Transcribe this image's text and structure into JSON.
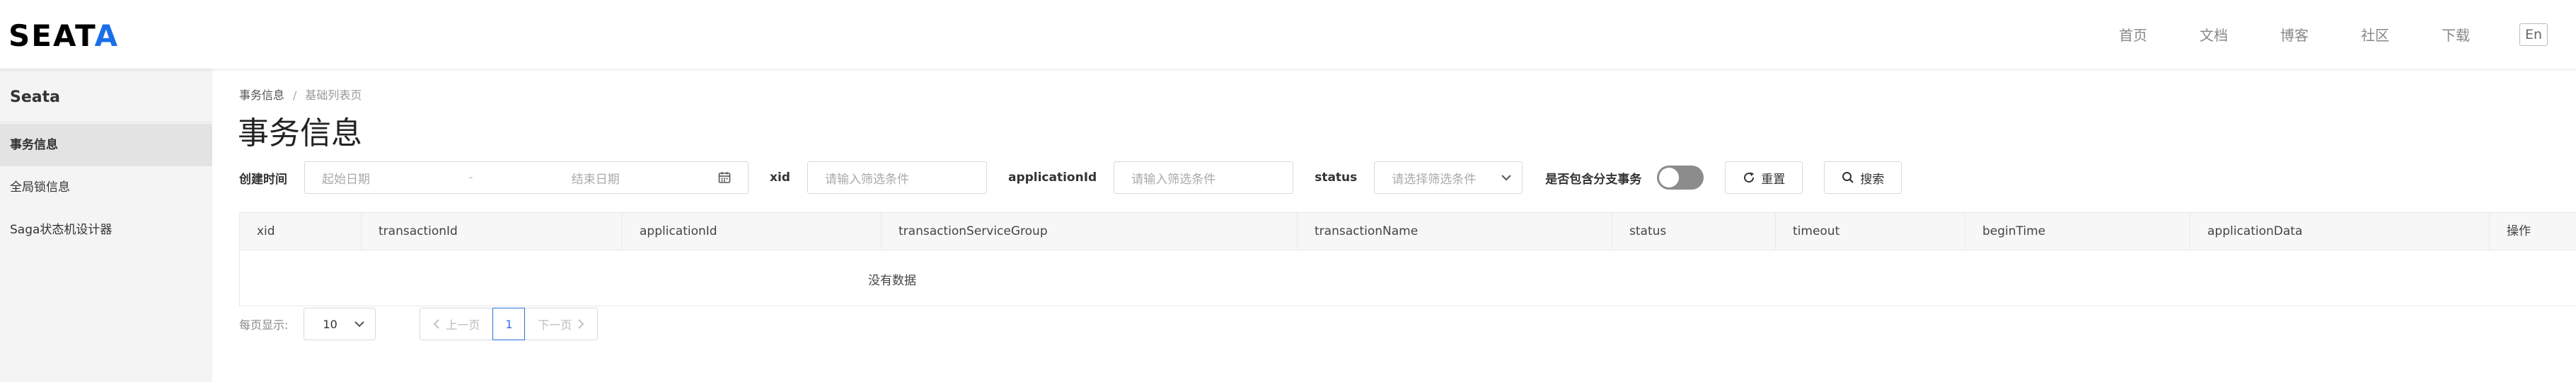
{
  "header": {
    "logo_main": "SEAT",
    "logo_accent": "A",
    "nav": [
      "首页",
      "文档",
      "博客",
      "社区",
      "下载"
    ],
    "lang": "En"
  },
  "sidebar": {
    "title": "Seata",
    "items": [
      {
        "label": "事务信息",
        "active": true
      },
      {
        "label": "全局锁信息",
        "active": false
      },
      {
        "label": "Saga状态机设计器",
        "active": false
      }
    ]
  },
  "breadcrumb": {
    "parent": "事务信息",
    "sep": "/",
    "current": "基础列表页"
  },
  "page_title": "事务信息",
  "filters": {
    "time_label": "创建时间",
    "start_placeholder": "起始日期",
    "range_dash": "-",
    "end_placeholder": "结束日期",
    "xid_label": "xid",
    "xid_placeholder": "请输入筛选条件",
    "app_label": "applicationId",
    "app_placeholder": "请输入筛选条件",
    "status_label": "status",
    "status_placeholder": "请选择筛选条件",
    "branch_label": "是否包含分支事务",
    "branch_on": false,
    "reset_label": "重置",
    "search_label": "搜索"
  },
  "table": {
    "columns": [
      "xid",
      "transactionId",
      "applicationId",
      "transactionServiceGroup",
      "transactionName",
      "status",
      "timeout",
      "beginTime",
      "applicationData",
      "操作"
    ],
    "empty_text": "没有数据"
  },
  "pagination": {
    "page_size_label": "每页显示:",
    "page_size": "10",
    "prev_label": "上一页",
    "current_page": "1",
    "next_label": "下一页"
  }
}
